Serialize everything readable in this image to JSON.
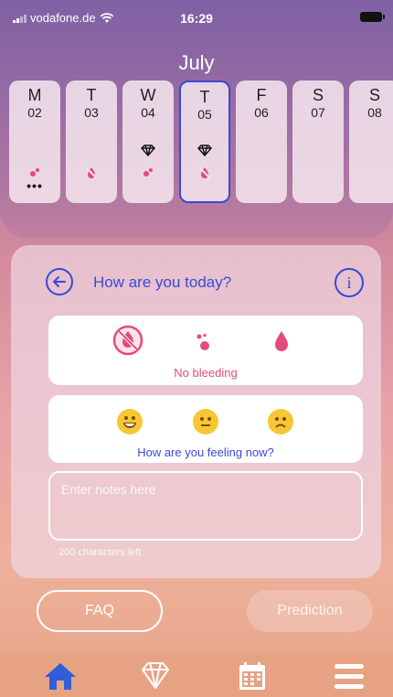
{
  "status_bar": {
    "carrier": "vodafone.de",
    "time": "16:29"
  },
  "calendar": {
    "month": "July",
    "days": [
      {
        "weekday": "M",
        "date": "02"
      },
      {
        "weekday": "T",
        "date": "03"
      },
      {
        "weekday": "W",
        "date": "04"
      },
      {
        "weekday": "T",
        "date": "05"
      },
      {
        "weekday": "F",
        "date": "06"
      },
      {
        "weekday": "S",
        "date": "07"
      },
      {
        "weekday": "S",
        "date": "08"
      }
    ],
    "selected_date": "05"
  },
  "checkin": {
    "question": "How are you today?",
    "bleeding_label": "No bleeding",
    "feeling_label": "How are you feeling now?",
    "notes_placeholder": "Enter notes here",
    "chars_left": "200 characters left"
  },
  "buttons": {
    "faq": "FAQ",
    "prediction": "Prediction"
  },
  "tabbar": {
    "items": [
      "home-icon",
      "diamond-icon",
      "calendar-icon",
      "menu-icon"
    ]
  },
  "colors": {
    "accent_blue": "#3b49d6",
    "accent_pink": "#e64a7d",
    "tabbar": "#e7a284"
  }
}
